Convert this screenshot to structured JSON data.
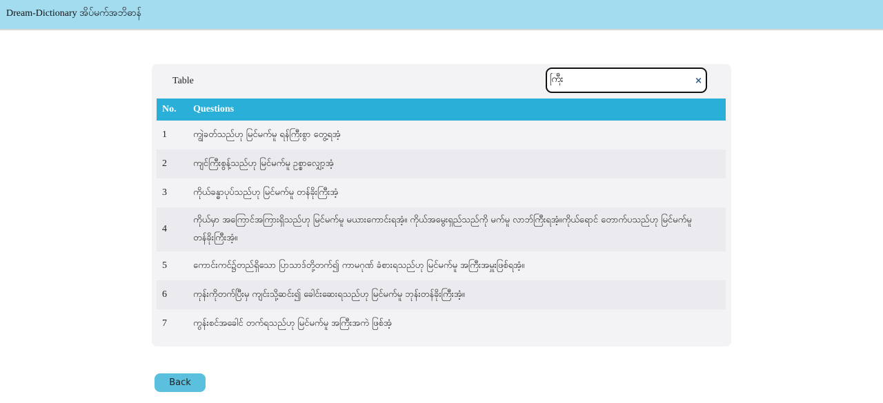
{
  "header": {
    "title": "Dream-Dictionary အိပ်မက်အဘိဓာန်"
  },
  "card": {
    "title": "Table",
    "search_value": "ကြီး",
    "clear_icon": "×"
  },
  "table": {
    "columns": [
      "No.",
      "Questions"
    ],
    "rows": [
      {
        "no": "1",
        "q": "ကျွဲခတ်သည်ဟု မြင်မက်မူ ရန်ကြီးစွာ တွေ့ရအံ့"
      },
      {
        "no": "2",
        "q": "ကျင်ကြီးစွန့်သည်ဟု မြင်မက်မူ ဥစ္စာလျှော့အံ့"
      },
      {
        "no": "3",
        "q": "ကိုယ်ခန္ဓာပုပ်သည်ဟု မြင်မက်မူ တန်ခိုးကြီးအံ့"
      },
      {
        "no": "4",
        "q": "ကိုယ်မှာ အကြောင်အကြားရှိသည်ဟု မြင်မက်မူ မယားကောင်းရအံ့။ ကိုယ်အမွေးရှည်သည်ကို မက်မူ လာဘ်ကြီးရအံ့။ကိုယ်ရောင် တောက်ပသည်ဟု မြင်မက်မူ တန်ခိုးကြီးအံ့။"
      },
      {
        "no": "5",
        "q": "ကောင်းကင်၌တည်ရှိသော ပြာသာဒ်တို့တက်၍ ကာမဂုဏ် ခံစားရသည်ဟု မြင်မက်မူ အကြီးအမှူးဖြစ်ရအံ့။"
      },
      {
        "no": "6",
        "q": "ကုန်းကိုတက်ပြီးမှ ကျင်းသို့ဆင်း၍ ခေါင်းဆေးရသည်ဟု မြင်မက်မူ ဘုန်းတန်ခိုးကြီးအံ့။"
      },
      {
        "no": "7",
        "q": "ကွန်းစင်အခေါင် တက်ရသည်ဟု မြင်မက်မူ အကြီးအကဲ ဖြစ်အံ့"
      }
    ]
  },
  "back_label": "Back",
  "colors": {
    "header_bg": "#a3dcef",
    "table_header": "#29afd8",
    "button": "#5bc0de"
  }
}
